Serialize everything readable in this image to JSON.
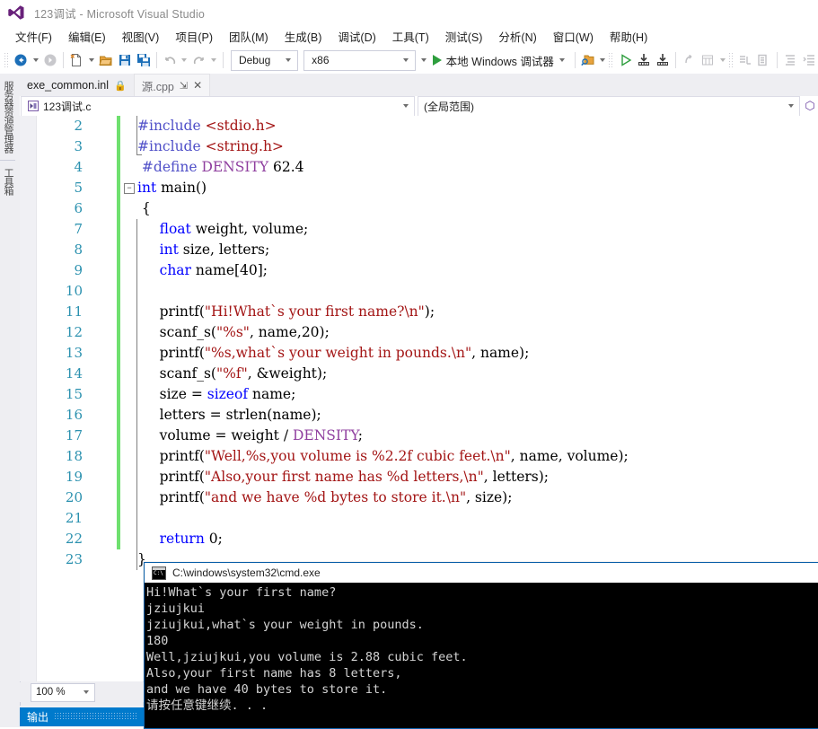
{
  "window": {
    "title": "123调试 - Microsoft Visual Studio",
    "logo_icon": "visual-studio-logo-icon"
  },
  "menu": {
    "items": [
      {
        "label": "文件(F)"
      },
      {
        "label": "编辑(E)"
      },
      {
        "label": "视图(V)"
      },
      {
        "label": "项目(P)"
      },
      {
        "label": "团队(M)"
      },
      {
        "label": "生成(B)"
      },
      {
        "label": "调试(D)"
      },
      {
        "label": "工具(T)"
      },
      {
        "label": "测试(S)"
      },
      {
        "label": "分析(N)"
      },
      {
        "label": "窗口(W)"
      },
      {
        "label": "帮助(H)"
      }
    ]
  },
  "toolbar": {
    "navigate_back_icon": "navigate-back-icon",
    "navigate_forward_icon": "navigate-forward-icon",
    "new_item_icon": "new-item-icon",
    "open_file_icon": "open-file-icon",
    "save_icon": "save-icon",
    "save_all_icon": "save-all-icon",
    "undo_icon": "undo-icon",
    "redo_icon": "redo-icon",
    "configuration": "Debug",
    "platform": "x86",
    "start_debug_label": "本地 Windows 调试器",
    "start_debug_icon": "play-icon",
    "find_icon": "find-in-files-icon",
    "step_into_icon": "step-into-icon",
    "step_over_icon": "step-over-icon",
    "comment_icon": "comment-icon",
    "uncomment_icon": "uncomment-icon",
    "indent_icon": "indent-icon",
    "outdent_icon": "outdent-icon"
  },
  "side_strip": {
    "tabs": [
      {
        "label": "服务器资源管理器"
      },
      {
        "label": "工具箱"
      }
    ]
  },
  "tabs": [
    {
      "label": "exe_common.inl",
      "active": false,
      "lock_icon": "lock-icon"
    },
    {
      "label": "源.cpp",
      "active": true,
      "pin_icon": "pin-icon",
      "close_icon": "close-icon"
    }
  ],
  "navbar": {
    "file": "123调试.c",
    "file_icon": "c-file-icon",
    "scope": "(全局范围)",
    "scope_cube_icon": "scope-cube-icon"
  },
  "editor": {
    "lines": [
      {
        "num": "2",
        "fold": false,
        "bar": true,
        "tokens": [
          {
            "t": "#include ",
            "c": "pp"
          },
          {
            "t": "<stdio.h>",
            "c": "hdr"
          }
        ]
      },
      {
        "num": "3",
        "fold": false,
        "bar": true,
        "tokens": [
          {
            "t": "#include ",
            "c": "pp"
          },
          {
            "t": "<string.h>",
            "c": "hdr"
          }
        ]
      },
      {
        "num": "4",
        "fold": false,
        "bar": true,
        "tokens": [
          {
            "t": " #define ",
            "c": "pp"
          },
          {
            "t": "DENSITY",
            "c": "mac"
          },
          {
            "t": " 62.4",
            "c": ""
          }
        ]
      },
      {
        "num": "5",
        "fold": true,
        "bar": true,
        "tokens": [
          {
            "t": "int",
            "c": "kw"
          },
          {
            "t": " main()",
            "c": ""
          }
        ]
      },
      {
        "num": "6",
        "fold": false,
        "bar": true,
        "tokens": [
          {
            "t": " {",
            "c": ""
          }
        ]
      },
      {
        "num": "7",
        "fold": false,
        "bar": true,
        "tokens": [
          {
            "t": "     ",
            "c": ""
          },
          {
            "t": "float",
            "c": "kw"
          },
          {
            "t": " weight, volume;",
            "c": ""
          }
        ]
      },
      {
        "num": "8",
        "fold": false,
        "bar": true,
        "tokens": [
          {
            "t": "     ",
            "c": ""
          },
          {
            "t": "int",
            "c": "kw"
          },
          {
            "t": " size, letters;",
            "c": ""
          }
        ]
      },
      {
        "num": "9",
        "fold": false,
        "bar": true,
        "tokens": [
          {
            "t": "     ",
            "c": ""
          },
          {
            "t": "char",
            "c": "kw"
          },
          {
            "t": " name[40];",
            "c": ""
          }
        ]
      },
      {
        "num": "10",
        "fold": false,
        "bar": true,
        "tokens": []
      },
      {
        "num": "11",
        "fold": false,
        "bar": true,
        "tokens": [
          {
            "t": "     printf(",
            "c": ""
          },
          {
            "t": "\"Hi!What`s your first name?\\n\"",
            "c": "str"
          },
          {
            "t": ");",
            "c": ""
          }
        ]
      },
      {
        "num": "12",
        "fold": false,
        "bar": true,
        "tokens": [
          {
            "t": "     scanf_s(",
            "c": ""
          },
          {
            "t": "\"%s\"",
            "c": "str"
          },
          {
            "t": ", name,20);",
            "c": ""
          }
        ]
      },
      {
        "num": "13",
        "fold": false,
        "bar": true,
        "tokens": [
          {
            "t": "     printf(",
            "c": ""
          },
          {
            "t": "\"%s,what`s your weight in pounds.\\n\"",
            "c": "str"
          },
          {
            "t": ", name);",
            "c": ""
          }
        ]
      },
      {
        "num": "14",
        "fold": false,
        "bar": true,
        "tokens": [
          {
            "t": "     scanf_s(",
            "c": ""
          },
          {
            "t": "\"%f\"",
            "c": "str"
          },
          {
            "t": ", &weight);",
            "c": ""
          }
        ]
      },
      {
        "num": "15",
        "fold": false,
        "bar": true,
        "tokens": [
          {
            "t": "     size = ",
            "c": ""
          },
          {
            "t": "sizeof",
            "c": "kw"
          },
          {
            "t": " name;",
            "c": ""
          }
        ]
      },
      {
        "num": "16",
        "fold": false,
        "bar": true,
        "tokens": [
          {
            "t": "     letters = strlen(name);",
            "c": ""
          }
        ]
      },
      {
        "num": "17",
        "fold": false,
        "bar": true,
        "tokens": [
          {
            "t": "     volume = weight / ",
            "c": ""
          },
          {
            "t": "DENSITY",
            "c": "mac"
          },
          {
            "t": ";",
            "c": ""
          }
        ]
      },
      {
        "num": "18",
        "fold": false,
        "bar": true,
        "tokens": [
          {
            "t": "     printf(",
            "c": ""
          },
          {
            "t": "\"Well,%s,you volume is %2.2f cubic feet.\\n\"",
            "c": "str"
          },
          {
            "t": ", name, volume);",
            "c": ""
          }
        ]
      },
      {
        "num": "19",
        "fold": false,
        "bar": true,
        "tokens": [
          {
            "t": "     printf(",
            "c": ""
          },
          {
            "t": "\"Also,your first name has %d letters,\\n\"",
            "c": "str"
          },
          {
            "t": ", letters);",
            "c": ""
          }
        ]
      },
      {
        "num": "20",
        "fold": false,
        "bar": true,
        "tokens": [
          {
            "t": "     printf(",
            "c": ""
          },
          {
            "t": "\"and we have %d bytes to store it.\\n\"",
            "c": "str"
          },
          {
            "t": ", size);",
            "c": ""
          }
        ]
      },
      {
        "num": "21",
        "fold": false,
        "bar": true,
        "tokens": []
      },
      {
        "num": "22",
        "fold": false,
        "bar": true,
        "tokens": [
          {
            "t": "     ",
            "c": ""
          },
          {
            "t": "return",
            "c": "kw"
          },
          {
            "t": " 0;",
            "c": ""
          }
        ]
      },
      {
        "num": "23",
        "fold": false,
        "bar": false,
        "tokens": [
          {
            "t": "}",
            "c": ""
          }
        ]
      }
    ]
  },
  "console": {
    "title": "C:\\windows\\system32\\cmd.exe",
    "icon": "cmd-icon",
    "output": "Hi!What`s your first name?\njziujkui\njziujkui,what`s your weight in pounds.\n180\nWell,jziujkui,you volume is 2.88 cubic feet.\nAlso,your first name has 8 letters,\nand we have 40 bytes to store it.\n请按任意键继续. . ."
  },
  "status": {
    "zoom": "100 %",
    "output_tab": "输出"
  },
  "colors": {
    "accent": "#007acc",
    "keyword": "#0000ff",
    "string": "#a31515",
    "preprocessor": "#5050c8",
    "macro": "#8f3f9f",
    "linenumber": "#2b91af",
    "changebar": "#6fe06f",
    "chrome": "#eeeef2"
  }
}
